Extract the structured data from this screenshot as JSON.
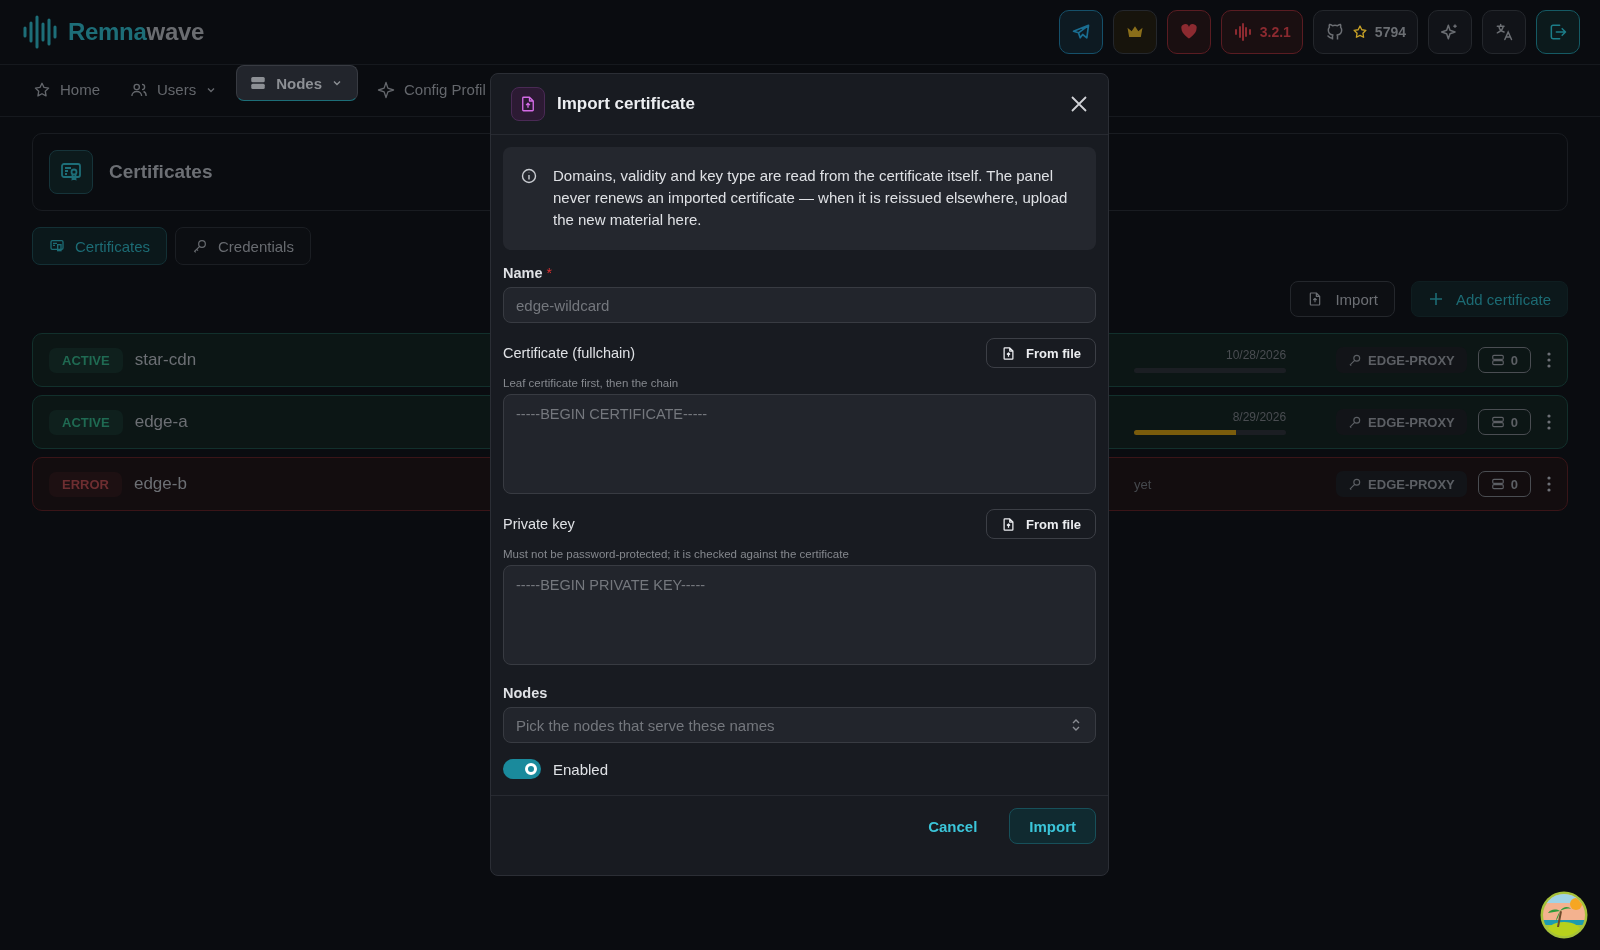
{
  "header": {
    "logo": [
      "Remna",
      "wave"
    ],
    "actions": [
      {
        "kind": "telegram"
      },
      {
        "kind": "crown"
      },
      {
        "kind": "heart"
      },
      {
        "kind": "version",
        "text": "3.2.1"
      },
      {
        "kind": "github",
        "text": "5794"
      },
      {
        "kind": "sparkles"
      },
      {
        "kind": "translate"
      },
      {
        "kind": "logout"
      }
    ]
  },
  "nav": [
    {
      "label": "Home",
      "dropdown": false,
      "selected": false
    },
    {
      "label": "Users",
      "dropdown": true,
      "selected": false
    },
    {
      "label": "Nodes",
      "dropdown": true,
      "selected": true
    },
    {
      "label": "Config Profil",
      "dropdown": false,
      "selected": false
    }
  ],
  "page": {
    "title": "Certificates",
    "tabs": [
      {
        "label": "Certificates",
        "selected": true
      },
      {
        "label": "Credentials",
        "selected": false
      }
    ],
    "actions": [
      {
        "label": "Import",
        "kind": "import"
      },
      {
        "label": "Add certificate",
        "kind": "add"
      }
    ],
    "rows": [
      {
        "status": "ACTIVE",
        "kind": "active",
        "name": "star-cdn",
        "date": "10/28/2026",
        "tag": "EDGE-PROXY",
        "nodes": "0"
      },
      {
        "status": "ACTIVE",
        "kind": "active",
        "name": "edge-a",
        "date": "8/29/2026",
        "level": 0.67,
        "tag": "EDGE-PROXY",
        "nodes": "0"
      },
      {
        "status": "ERROR",
        "kind": "error",
        "name": "edge-b",
        "note": "yet",
        "tag": "EDGE-PROXY",
        "nodes": "0"
      }
    ]
  },
  "dialog": {
    "title": "Import certificate",
    "info": "Domains, validity and key type are read from the certificate itself. The panel never renews an imported certificate — when it is reissued elsewhere, upload the new material here.",
    "name": {
      "label": "Name",
      "required_mark": "*",
      "placeholder": "edge-wildcard"
    },
    "certificate": {
      "label": "Certificate (fullchain)",
      "button": "From file",
      "hint": "Leaf certificate first, then the chain",
      "placeholder": "-----BEGIN CERTIFICATE-----"
    },
    "private_key": {
      "label": "Private key",
      "button": "From file",
      "hint": "Must not be password-protected; it is checked against the certificate",
      "placeholder": "-----BEGIN PRIVATE KEY-----"
    },
    "nodes": {
      "label": "Nodes",
      "placeholder": "Pick the nodes that serve these names"
    },
    "enabled": {
      "label": "Enabled",
      "on": true
    },
    "buttons": [
      "Cancel",
      "Import"
    ]
  }
}
